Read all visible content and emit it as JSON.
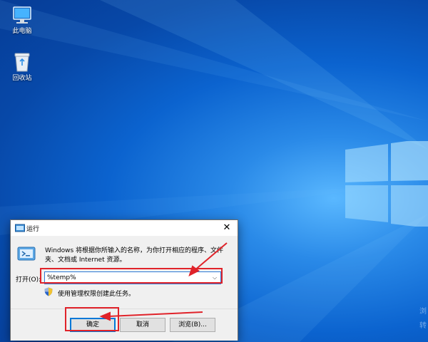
{
  "desktop": {
    "icons": [
      {
        "label": "此电脑",
        "icon": "computer-icon"
      },
      {
        "label": "回收站",
        "icon": "recycle-bin-icon"
      }
    ],
    "corner_text": [
      "浏",
      "转"
    ]
  },
  "run_dialog": {
    "title": "运行",
    "description": "Windows 将根据你所输入的名称，为你打开相应的程序、文件夹、文档或 Internet 资源。",
    "open_label": "打开(O):",
    "input_value": "%temp%",
    "admin_note": "使用管理权限创建此任务。",
    "buttons": {
      "ok": "确定",
      "cancel": "取消",
      "browse": "浏览(B)..."
    },
    "close_glyph": "✕",
    "dropdown_glyph": "⌵"
  },
  "colors": {
    "annotation_red": "#e0232a",
    "focus_blue": "#0078d7"
  }
}
